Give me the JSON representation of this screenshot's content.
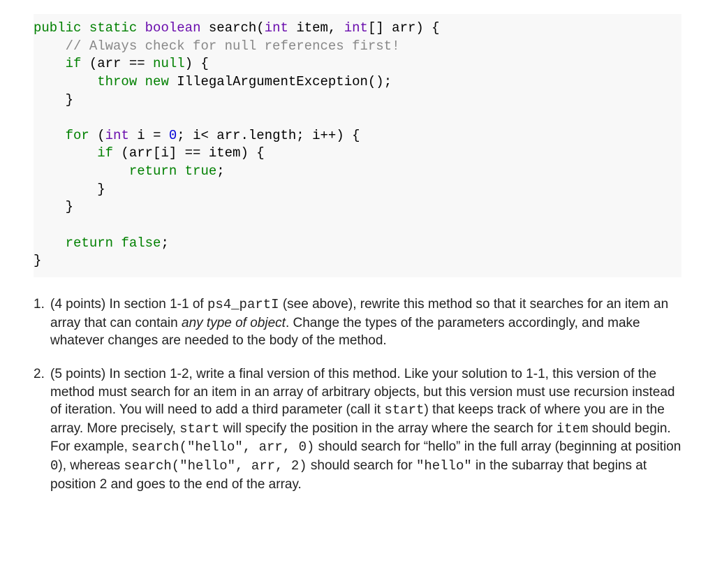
{
  "code": {
    "tokens": [
      [
        {
          "t": "public",
          "c": "kw"
        },
        {
          "t": " "
        },
        {
          "t": "static",
          "c": "kw"
        },
        {
          "t": " "
        },
        {
          "t": "boolean",
          "c": "type"
        },
        {
          "t": " search("
        },
        {
          "t": "int",
          "c": "type"
        },
        {
          "t": " item, "
        },
        {
          "t": "int",
          "c": "type"
        },
        {
          "t": "[] arr) {"
        }
      ],
      [
        {
          "t": "    "
        },
        {
          "t": "// Always check for null references first!",
          "c": "cmt"
        }
      ],
      [
        {
          "t": "    "
        },
        {
          "t": "if",
          "c": "kw"
        },
        {
          "t": " (arr == "
        },
        {
          "t": "null",
          "c": "kw"
        },
        {
          "t": ") {"
        }
      ],
      [
        {
          "t": "        "
        },
        {
          "t": "throw",
          "c": "kw"
        },
        {
          "t": " "
        },
        {
          "t": "new",
          "c": "kw"
        },
        {
          "t": " IllegalArgumentException();"
        }
      ],
      [
        {
          "t": "    }"
        }
      ],
      [
        {
          "t": ""
        }
      ],
      [
        {
          "t": "    "
        },
        {
          "t": "for",
          "c": "kw"
        },
        {
          "t": " ("
        },
        {
          "t": "int",
          "c": "type"
        },
        {
          "t": " i = "
        },
        {
          "t": "0",
          "c": "lit"
        },
        {
          "t": "; i< arr.length; i++) {"
        }
      ],
      [
        {
          "t": "        "
        },
        {
          "t": "if",
          "c": "kw"
        },
        {
          "t": " (arr[i] == item) {"
        }
      ],
      [
        {
          "t": "            "
        },
        {
          "t": "return",
          "c": "kw"
        },
        {
          "t": " "
        },
        {
          "t": "true",
          "c": "kw"
        },
        {
          "t": ";"
        }
      ],
      [
        {
          "t": "        }"
        }
      ],
      [
        {
          "t": "    }"
        }
      ],
      [
        {
          "t": ""
        }
      ],
      [
        {
          "t": "    "
        },
        {
          "t": "return",
          "c": "kw"
        },
        {
          "t": " "
        },
        {
          "t": "false",
          "c": "kw"
        },
        {
          "t": ";"
        }
      ],
      [
        {
          "t": "}"
        }
      ]
    ]
  },
  "questions": [
    {
      "num": "1.",
      "segments": [
        {
          "t": "(4 points) In section 1-1 of "
        },
        {
          "t": "ps4_partI",
          "mono": true
        },
        {
          "t": " (see above), rewrite this method so that it searches for an item an array that can contain "
        },
        {
          "t": "any type of object",
          "italic": true
        },
        {
          "t": ". Change the types of the parameters accordingly, and make whatever changes are needed to the body of the method."
        }
      ]
    },
    {
      "num": "2.",
      "segments": [
        {
          "t": "(5 points) In section 1-2, write a final version of this method. Like your solution to 1-1, this version of the method must search for an item in an array of arbitrary objects, but this version must use recursion instead of iteration. You will need to add a third parameter (call it "
        },
        {
          "t": "start",
          "mono": true
        },
        {
          "t": ") that keeps track of where you are in the array. More precisely, "
        },
        {
          "t": "start",
          "mono": true
        },
        {
          "t": " will specify the position in the array where the search for "
        },
        {
          "t": "item",
          "mono": true
        },
        {
          "t": " should begin. For example, "
        },
        {
          "t": "search(\"hello\", arr, 0)",
          "mono": true
        },
        {
          "t": " should search for “hello” in the full array (beginning at position "
        },
        {
          "t": "0",
          "mono": true
        },
        {
          "t": "), whereas "
        },
        {
          "t": "search(\"hello\", arr, 2)",
          "mono": true
        },
        {
          "t": " should search for "
        },
        {
          "t": "\"hello\"",
          "mono": true
        },
        {
          "t": " in the subarray that begins at position 2 and goes to the end of the array."
        }
      ]
    }
  ]
}
